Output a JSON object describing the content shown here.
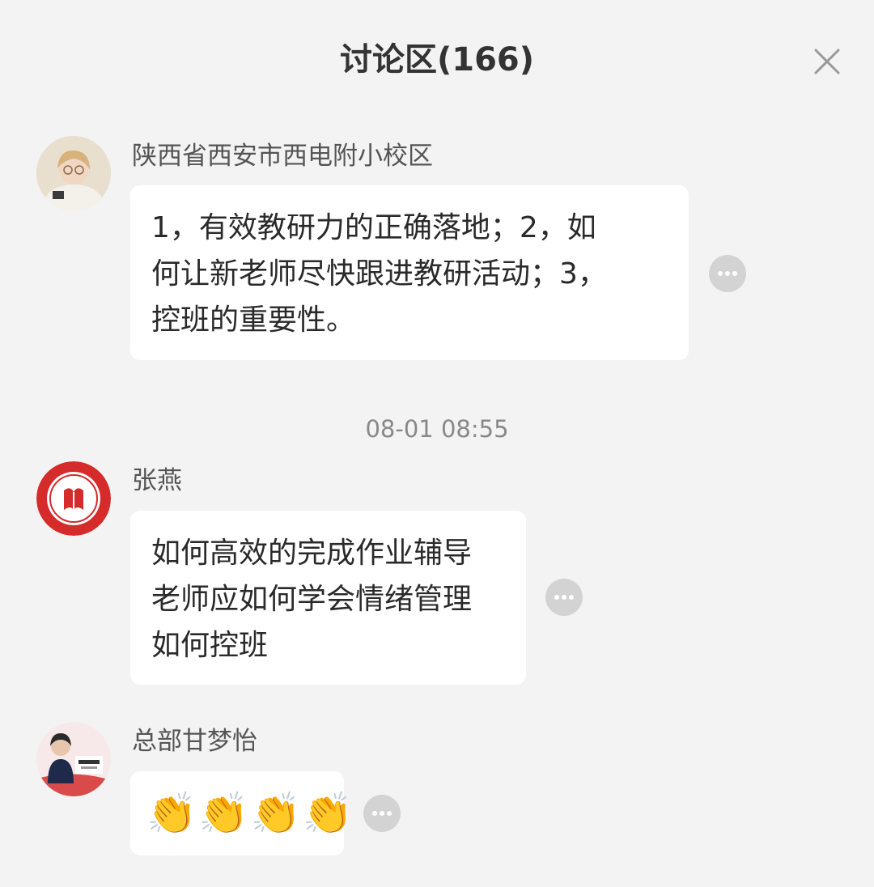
{
  "header": {
    "title": "讨论区(166)"
  },
  "timestamp": "08-01 08:55",
  "messages": [
    {
      "author": "陕西省西安市西电附小校区",
      "lines": [
        "1，有效教研力的正确落地；2，如",
        "何让新老师尽快跟进教研活动；3，",
        "控班的重要性。"
      ]
    },
    {
      "author": "张燕",
      "lines": [
        "如何高效的完成作业辅导",
        "老师应如何学会情绪管理",
        "如何控班"
      ]
    },
    {
      "author": "总部甘梦怡",
      "lines": [
        "👏👏👏👏"
      ]
    }
  ],
  "icons": {
    "close": "close-icon",
    "more": "more-icon"
  },
  "colors": {
    "background": "#f3f3f3",
    "bubble": "#ffffff",
    "more_button": "#d3d3d3",
    "badge_red": "#d52b2b"
  }
}
